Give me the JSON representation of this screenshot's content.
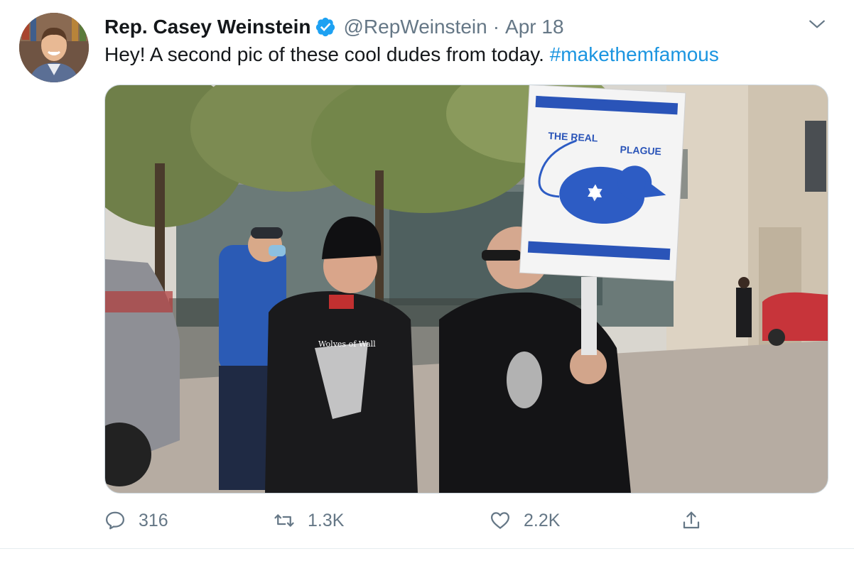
{
  "tweet": {
    "author_name": "Rep. Casey Weinstein",
    "handle": "@RepWeinstein",
    "separator": "·",
    "date": "Apr 18",
    "text_before": "Hey! A second pic of these cool dudes from today. ",
    "hashtag": "#makethemfamous",
    "media": {
      "sign_text_left": "THE REAL",
      "sign_text_right": "PLAGUE",
      "shirt_text": "Wolves of Wall"
    },
    "actions": {
      "replies": "316",
      "retweets": "1.3K",
      "likes": "2.2K"
    }
  },
  "icons": {
    "verified": "verified-badge-icon",
    "caret": "chevron-down-icon",
    "reply": "reply-icon",
    "retweet": "retweet-icon",
    "like": "heart-icon",
    "share": "share-icon"
  },
  "colors": {
    "link": "#1b95e0",
    "muted": "#657786",
    "verified": "#1da1f2",
    "sign_blue": "#2a54b8"
  }
}
